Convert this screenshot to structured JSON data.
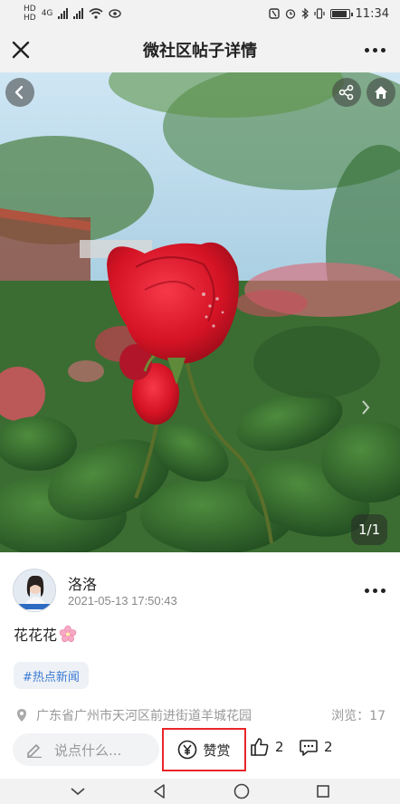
{
  "status_bar": {
    "sim1": "HD",
    "sim2": "HD",
    "network": "4G",
    "time": "11:34"
  },
  "nav": {
    "title": "微社区帖子详情",
    "close_icon": "close-icon",
    "more_icon": "more-icon"
  },
  "photo": {
    "counter": "1/1",
    "buttons": [
      "back-icon",
      "share-icon",
      "home-icon"
    ]
  },
  "post": {
    "author": "洛洛",
    "time": "2021-05-13 17:50:43",
    "content": "花花花",
    "content_emoji": "cherry-blossom-icon",
    "hashtag": "#热点新闻",
    "location": "广东省广州市天河区前进街道羊城花园",
    "views": "浏览：17"
  },
  "actions": {
    "comment_placeholder": "说点什么...",
    "reward_label": "赞赏",
    "like_count": "2",
    "comment_count": "2"
  },
  "colors": {
    "accent_tag": "#3a7bd5",
    "highlight_border": "#e8262a",
    "bar_bg": "#f2f2f2"
  }
}
